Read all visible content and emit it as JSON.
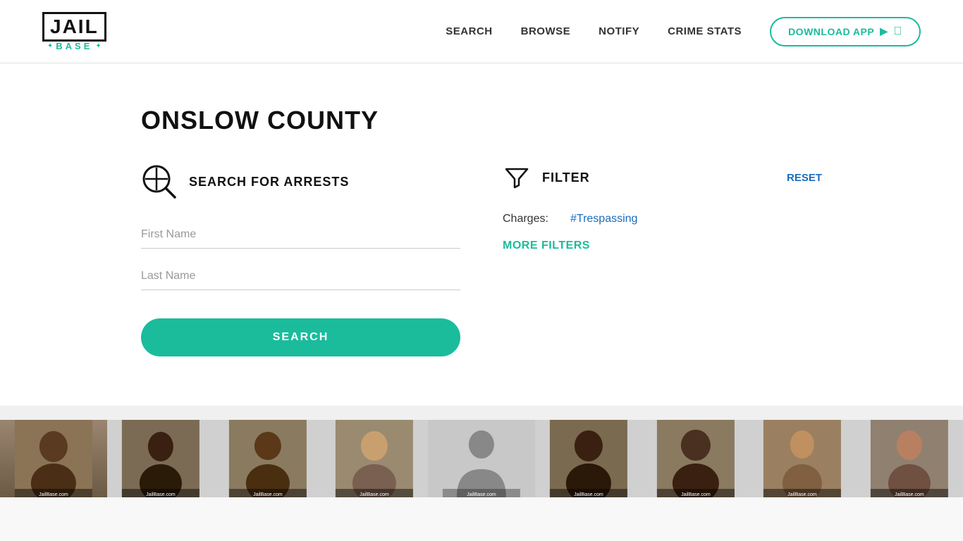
{
  "header": {
    "logo_jail": "JAIL",
    "logo_base": "BASE",
    "nav": {
      "search": "SEARCH",
      "browse": "BROWSE",
      "notify": "NOTIFY",
      "crime_stats": "CRIME STATS",
      "download_app": "DOWNLOAD APP"
    }
  },
  "page": {
    "title": "ONSLOW COUNTY",
    "search_section": {
      "icon_label": "search-arrests-icon",
      "title": "SEARCH FOR ARRESTS",
      "first_name_placeholder": "First Name",
      "last_name_placeholder": "Last Name",
      "search_button": "SEARCH"
    },
    "filter_section": {
      "icon_label": "filter-icon",
      "title": "FILTER",
      "reset_label": "RESET",
      "charges_label": "Charges:",
      "charges_tag": "#Trespassing",
      "more_filters_label": "MORE FILTERS"
    }
  },
  "mugshots": {
    "watermark": "JailBase.com",
    "items": [
      {
        "id": 1,
        "has_photo": true,
        "bg": "#8B7355"
      },
      {
        "id": 2,
        "has_photo": true,
        "bg": "#7B6B55"
      },
      {
        "id": 3,
        "has_photo": true,
        "bg": "#6B7B55"
      },
      {
        "id": 4,
        "has_photo": true,
        "bg": "#7B7B65"
      },
      {
        "id": 5,
        "has_photo": false,
        "bg": "#c8c8c8"
      },
      {
        "id": 6,
        "has_photo": true,
        "bg": "#7B6B45"
      },
      {
        "id": 7,
        "has_photo": true,
        "bg": "#8B7B55"
      },
      {
        "id": 8,
        "has_photo": true,
        "bg": "#7B7B55"
      },
      {
        "id": 9,
        "has_photo": true,
        "bg": "#8B8B65"
      }
    ]
  }
}
